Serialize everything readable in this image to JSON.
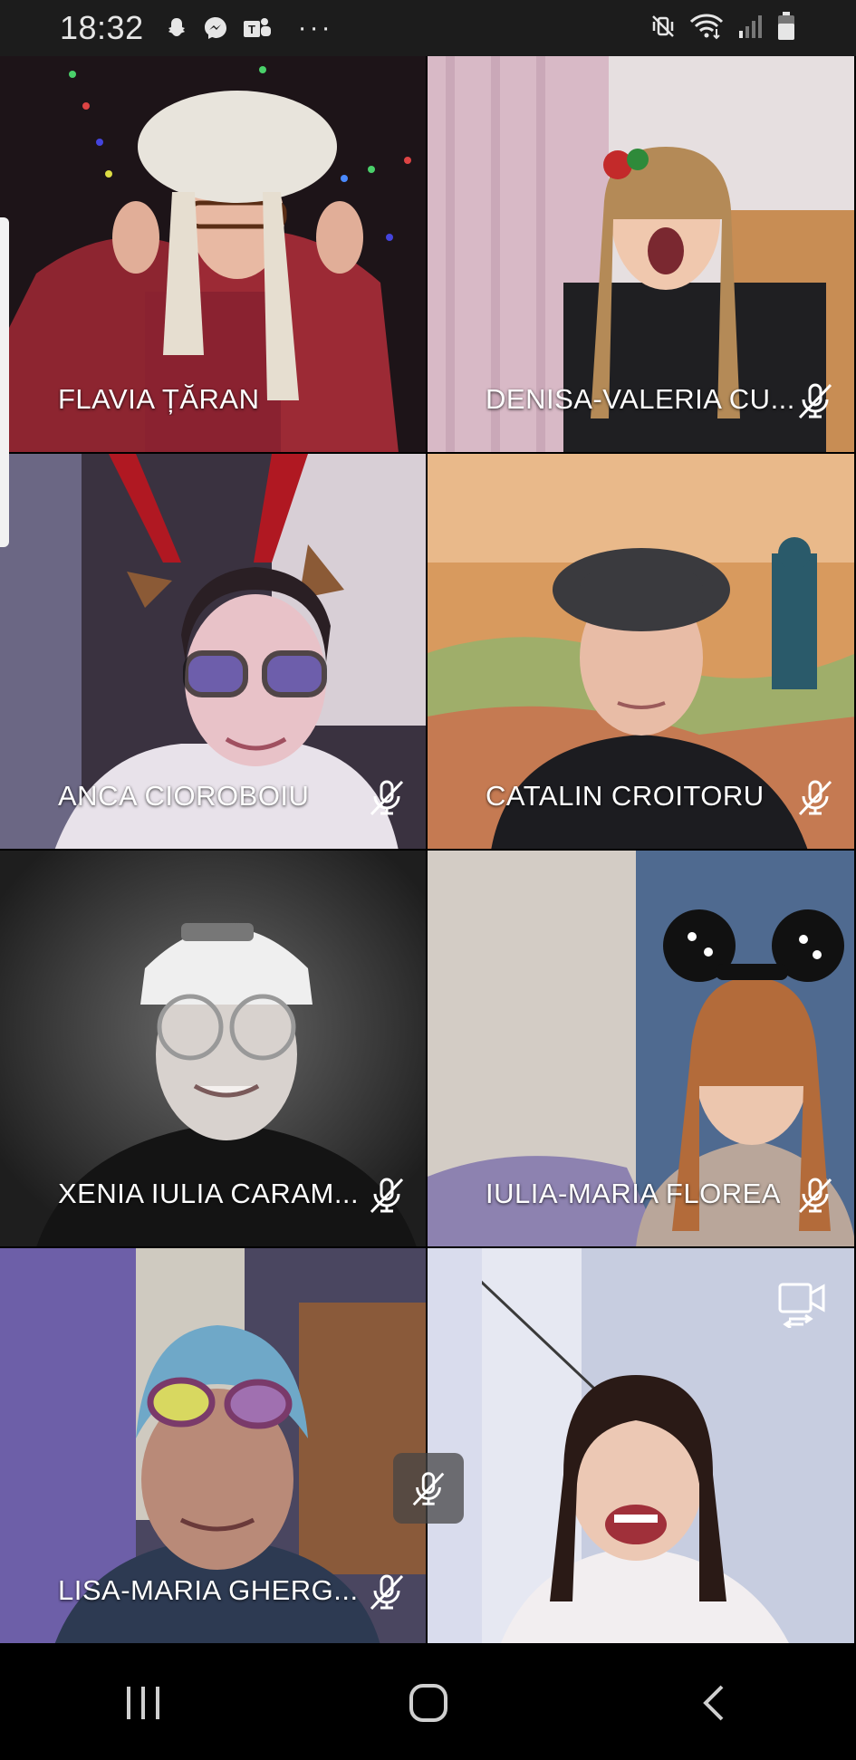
{
  "status_bar": {
    "time": "18:32",
    "left_icons": [
      "snapchat-icon",
      "messenger-icon",
      "teams-icon",
      "more-dots-icon"
    ],
    "more_text": "···",
    "right_icons": [
      "vibrate-muted-icon",
      "wifi-icon",
      "signal-icon",
      "battery-icon"
    ]
  },
  "participants": [
    {
      "name": "FLAVIA ȚĂRAN",
      "muted": false,
      "bg": "#2a1a1e"
    },
    {
      "name": "DENISA-VALERIA CU...",
      "muted": true,
      "bg": "#d9c8cf"
    },
    {
      "name": "ANCA CIOROBOIU",
      "muted": true,
      "bg": "#3a3342"
    },
    {
      "name": "CATALIN CROITORU",
      "muted": true,
      "bg": "#c98a55"
    },
    {
      "name": "XENIA IULIA CARAM...",
      "muted": true,
      "bg": "#2b2b2b"
    },
    {
      "name": "IULIA-MARIA FLOREA",
      "muted": true,
      "bg": "#c9c3bd"
    },
    {
      "name": "LISA-MARIA GHERG...",
      "muted": true,
      "bg": "#4d4a6a"
    },
    {
      "name": "",
      "muted": false,
      "bg": "#c8cfe0"
    }
  ],
  "overlay": {
    "floating_mic": "mic-off-icon",
    "switch_camera": "switch-camera-icon"
  },
  "nav_bar": {
    "buttons": [
      "recent-apps-icon",
      "home-icon",
      "back-icon"
    ]
  },
  "colors": {
    "status_bar_bg": "#1c1c1c",
    "label_text": "#ffffff"
  }
}
